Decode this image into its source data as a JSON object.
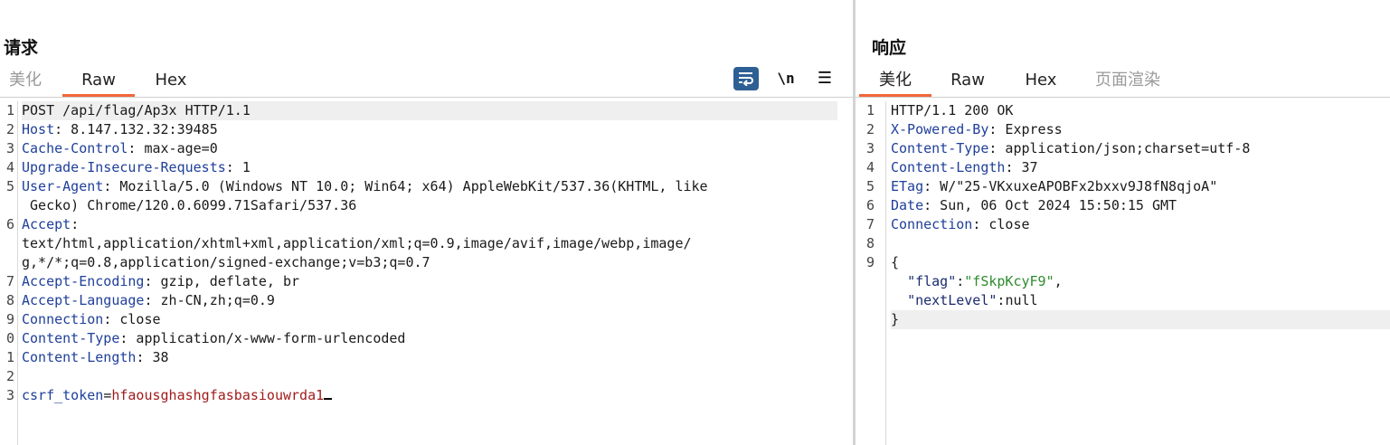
{
  "request": {
    "title": "请求",
    "tabs": [
      {
        "label": "美化",
        "state": "inactive"
      },
      {
        "label": "Raw",
        "state": "active"
      },
      {
        "label": "Hex",
        "state": "inactive"
      }
    ],
    "toolbar": {
      "wrap_icon": "word-wrap-icon",
      "newline_label": "\\n",
      "menu_label": "☰",
      "wrap_color": "#2e5f94"
    },
    "lines": [
      {
        "num": "1",
        "text": "POST /api/flag/Ap3x HTTP/1.1"
      },
      {
        "num": "2",
        "key": "Host",
        "value": " 8.147.132.32:39485"
      },
      {
        "num": "3",
        "key": "Cache-Control",
        "value": " max-age=0"
      },
      {
        "num": "4",
        "key": "Upgrade-Insecure-Requests",
        "value": " 1"
      },
      {
        "num": "5",
        "key": "User-Agent",
        "value": " Mozilla/5.0 (Windows NT 10.0; Win64; x64) AppleWebKit/537.36(KHTML, like"
      },
      {
        "num": "",
        "text": " Gecko) Chrome/120.0.6099.71Safari/537.36"
      },
      {
        "num": "6",
        "key": "Accept",
        "value": ""
      },
      {
        "num": "",
        "text": "text/html,application/xhtml+xml,application/xml;q=0.9,image/avif,image/webp,image/"
      },
      {
        "num": "",
        "text": "g,*/*;q=0.8,application/signed-exchange;v=b3;q=0.7"
      },
      {
        "num": "7",
        "key": "Accept-Encoding",
        "value": " gzip, deflate, br"
      },
      {
        "num": "8",
        "key": "Accept-Language",
        "value": " zh-CN,zh;q=0.9"
      },
      {
        "num": "9",
        "key": "Connection",
        "value": " close"
      },
      {
        "num": "0",
        "key": "Content-Type",
        "value": " application/x-www-form-urlencoded"
      },
      {
        "num": "1",
        "key": "Content-Length",
        "value": " 38"
      },
      {
        "num": "2",
        "text": ""
      },
      {
        "num": "3",
        "param_name": "csrf_token",
        "param_value": "hfaousghashgfasbasiouwrda1"
      }
    ]
  },
  "response": {
    "title": "响应",
    "tabs": [
      {
        "label": "美化",
        "state": "active"
      },
      {
        "label": "Raw",
        "state": "inactive"
      },
      {
        "label": "Hex",
        "state": "inactive"
      },
      {
        "label": "页面渲染",
        "state": "disabled"
      }
    ],
    "accent_color": "#f2663b",
    "lines": [
      {
        "num": "1",
        "text": "HTTP/1.1 200 OK"
      },
      {
        "num": "2",
        "key": "X-Powered-By",
        "value": " Express"
      },
      {
        "num": "3",
        "key": "Content-Type",
        "value": " application/json;charset=utf-8"
      },
      {
        "num": "4",
        "key": "Content-Length",
        "value": " 37"
      },
      {
        "num": "5",
        "key": "ETag",
        "value": " W/\"25-VKxuxeAPOBFx2bxxv9J8fN8qjoA\""
      },
      {
        "num": "6",
        "key": "Date",
        "value": " Sun, 06 Oct 2024 15:50:15 GMT"
      },
      {
        "num": "7",
        "key": "Connection",
        "value": " close"
      },
      {
        "num": "8",
        "text": ""
      },
      {
        "num": "9",
        "text": "{"
      },
      {
        "num": "",
        "json_key": "\"flag\"",
        "json_value": "\"fSkpKcyF9\"",
        "trail": ","
      },
      {
        "num": "",
        "json_key": "\"nextLevel\"",
        "json_plain": "null",
        "trail": ""
      },
      {
        "num": "",
        "text": "}"
      }
    ]
  }
}
